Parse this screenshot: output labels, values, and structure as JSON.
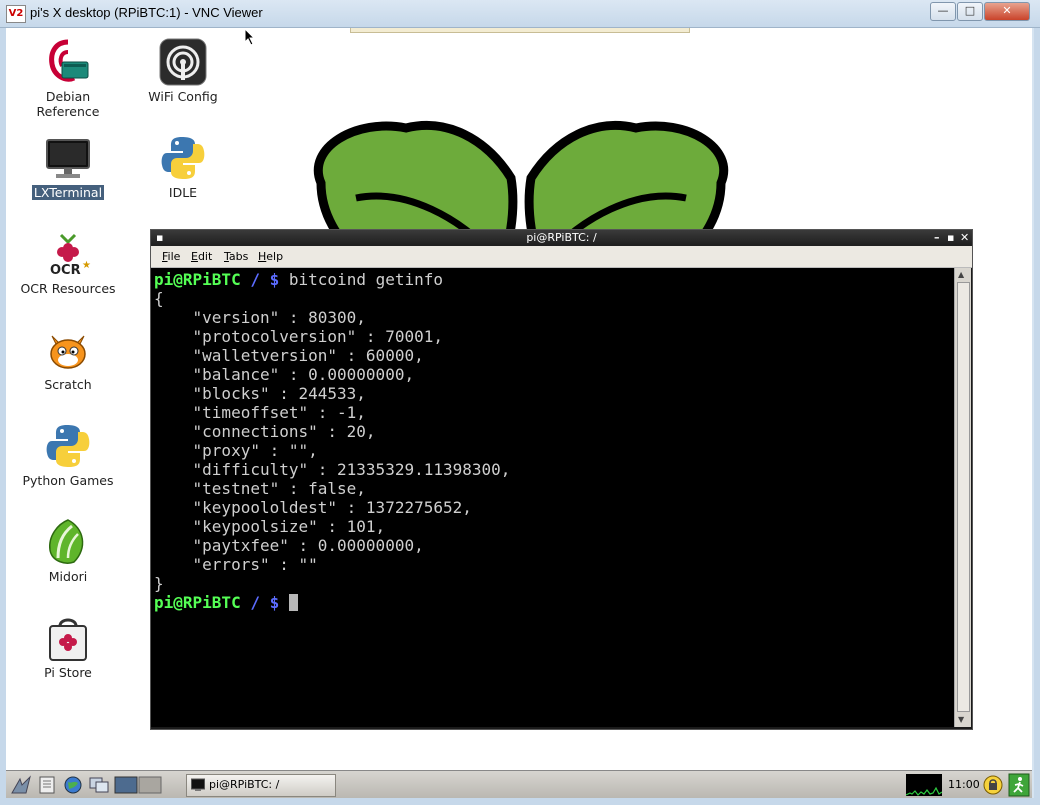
{
  "vnc_window": {
    "title": "pi's X desktop (RPiBTC:1) - VNC Viewer",
    "app_icon": "V2",
    "controls": {
      "minimize": "—",
      "maximize": "□",
      "close": "✕"
    }
  },
  "desktop_icons": [
    {
      "id": "debian-reference",
      "label": "Debian Reference",
      "icon": "debian-icon"
    },
    {
      "id": "wifi-config",
      "label": "WiFi Config",
      "icon": "wifi-icon"
    },
    {
      "id": "lxterminal",
      "label": "LXTerminal",
      "icon": "monitor-icon",
      "selected": true
    },
    {
      "id": "idle",
      "label": "IDLE",
      "icon": "python-icon"
    },
    {
      "id": "ocr-resources",
      "label": "OCR Resources",
      "icon": "raspberry-ocr-icon"
    },
    {
      "id": "scratch",
      "label": "Scratch",
      "icon": "scratch-cat-icon"
    },
    {
      "id": "python-games",
      "label": "Python Games",
      "icon": "python-icon"
    },
    {
      "id": "midori",
      "label": "Midori",
      "icon": "midori-leaf-icon"
    },
    {
      "id": "pi-store",
      "label": "Pi Store",
      "icon": "pi-store-bag-icon"
    }
  ],
  "terminal": {
    "title": "pi@RPiBTC: /",
    "menu": [
      "File",
      "Edit",
      "Tabs",
      "Help"
    ],
    "prompt_user": "pi@RPiBTC",
    "prompt_path": "/ $",
    "command": "bitcoind getinfo",
    "output_lines": [
      "{",
      "    \"version\" : 80300,",
      "    \"protocolversion\" : 70001,",
      "    \"walletversion\" : 60000,",
      "    \"balance\" : 0.00000000,",
      "    \"blocks\" : 244533,",
      "    \"timeoffset\" : -1,",
      "    \"connections\" : 20,",
      "    \"proxy\" : \"\",",
      "    \"difficulty\" : 21335329.11398300,",
      "    \"testnet\" : false,",
      "    \"keypoololdest\" : 1372275652,",
      "    \"keypoolsize\" : 101,",
      "    \"paytxfee\" : 0.00000000,",
      "    \"errors\" : \"\"",
      "}"
    ]
  },
  "taskbar": {
    "task_label": "pi@RPiBTC: /",
    "clock": "11:00"
  },
  "colors": {
    "prompt_user": "#55ff55",
    "prompt_path": "#5c6cff",
    "terminal_bg": "#000000",
    "leaf_green": "#6dab3b"
  }
}
